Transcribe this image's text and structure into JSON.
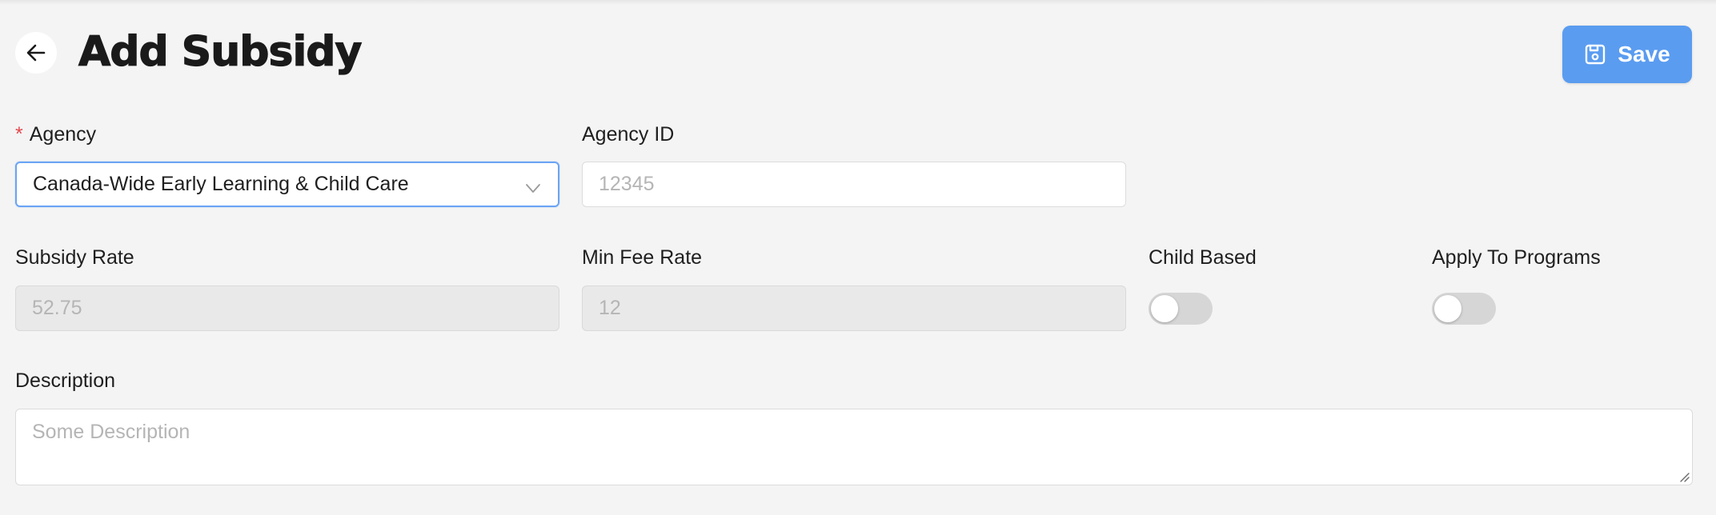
{
  "header": {
    "title": "Add Subsidy",
    "save_label": "Save"
  },
  "form": {
    "agency": {
      "label": "Agency",
      "required_mark": "*",
      "value": "Canada-Wide Early Learning & Child Care"
    },
    "agency_id": {
      "label": "Agency ID",
      "placeholder": "12345"
    },
    "subsidy_rate": {
      "label": "Subsidy Rate",
      "value": "52.75"
    },
    "min_fee_rate": {
      "label": "Min Fee Rate",
      "value": "12"
    },
    "child_based": {
      "label": "Child Based",
      "checked": false
    },
    "apply_to_programs": {
      "label": "Apply To Programs",
      "checked": false
    },
    "description": {
      "label": "Description",
      "placeholder": "Some Description"
    }
  },
  "colors": {
    "accent": "#5a9cf0",
    "background": "#f4f4f4",
    "required": "#e5484d"
  },
  "icons": {
    "back": "arrow-left-icon",
    "save": "save-icon",
    "select": "chevron-down-icon"
  }
}
